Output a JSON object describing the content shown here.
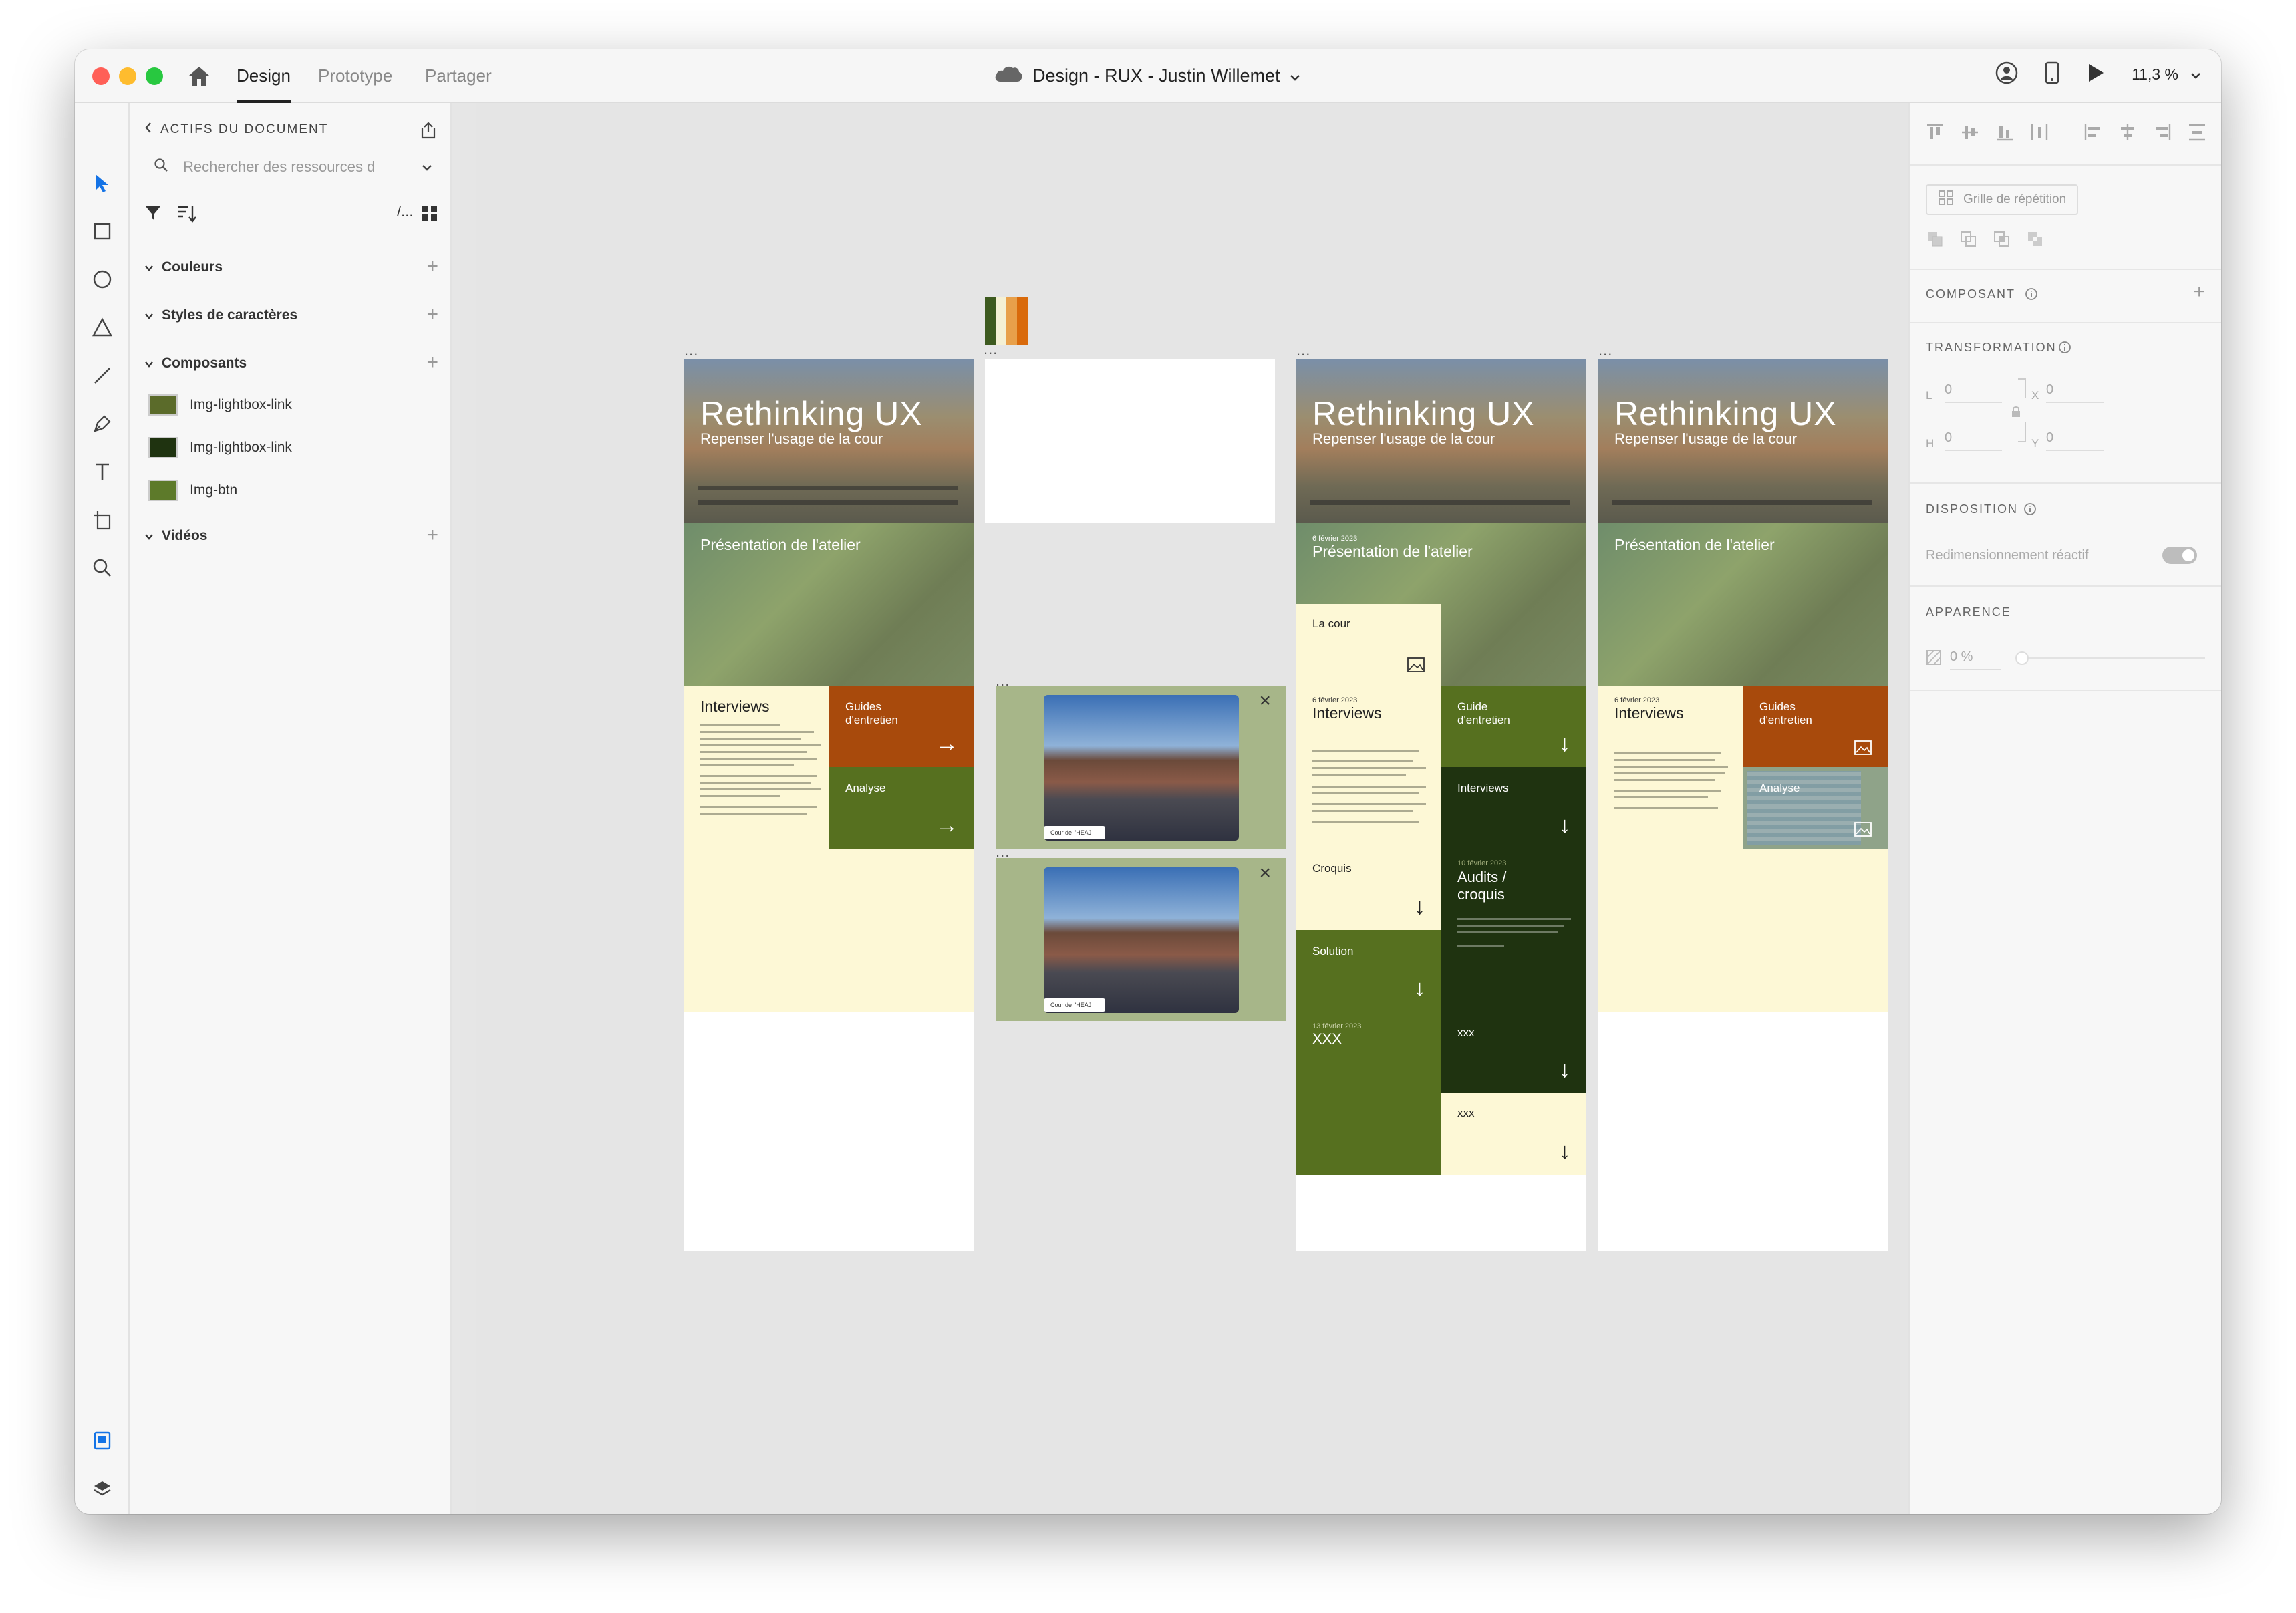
{
  "titlebar": {
    "tabs": [
      {
        "label": "Design"
      },
      {
        "label": "Prototype"
      },
      {
        "label": "Partager"
      }
    ],
    "doc_title": "Design - RUX - Justin Willemet",
    "zoom": "11,3 %"
  },
  "assets": {
    "header": "ACTIFS DU DOCUMENT",
    "search_placeholder": "Rechercher des ressources d",
    "sections": [
      {
        "label": "Couleurs"
      },
      {
        "label": "Styles de caractères"
      },
      {
        "label": "Composants"
      },
      {
        "label": "Vidéos"
      }
    ],
    "components": [
      {
        "label": "Img-lightbox-link"
      },
      {
        "label": "Img-lightbox-link"
      },
      {
        "label": "Img-btn"
      }
    ],
    "filter_icon_text": "/..."
  },
  "props": {
    "repeat_grid": "Grille de répétition",
    "composant": "COMPOSANT",
    "transformation": "TRANSFORMATION",
    "w_label": "L",
    "w_val": "0",
    "x_label": "X",
    "x_val": "0",
    "h_label": "H",
    "h_val": "0",
    "y_label": "Y",
    "y_val": "0",
    "disposition": "DISPOSITION",
    "responsive": "Redimensionnement réactif",
    "apparence": "APPARENCE",
    "opacity": "0 %"
  },
  "canvas": {
    "dots": "...",
    "hero_title": "Rethinking UX",
    "hero_subtitle": "Repenser l'usage de la cour",
    "presentation": "Présentation de l'atelier",
    "interviews": "Interviews",
    "guides": "Guides d'entretien",
    "guide": "Guide d'entretien",
    "analyse": "Analyse",
    "la_cour": "La cour",
    "croquis": "Croquis",
    "solution": "Solution",
    "audits": "Audits / croquis",
    "xxx": "XXX",
    "xxx_small": "xxx",
    "date_feb6": "6 février 2023",
    "date_feb10": "10 février 2023",
    "date_feb13": "13 février 2023",
    "photo_caption": "Cour de l'HEAJ",
    "arrow_right": "→",
    "arrow_down": "↓",
    "close": "×",
    "palette": [
      "#3d5a1f",
      "#f4f0d4",
      "#e8a04a",
      "#d96a0b"
    ]
  }
}
